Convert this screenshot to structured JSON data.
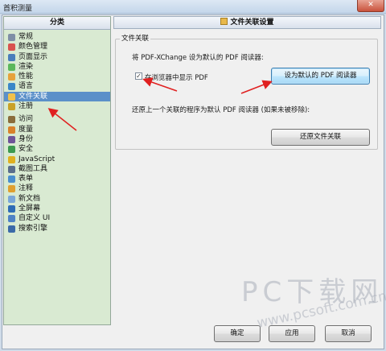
{
  "window": {
    "title": "首积测量",
    "close_label": "✕"
  },
  "sidebar": {
    "header": "分类",
    "items": [
      {
        "label": "常规",
        "icon": "gear-icon",
        "color": "#7f8fa6"
      },
      {
        "label": "颜色管理",
        "icon": "palette-icon",
        "color": "#d9534f"
      },
      {
        "label": "页面显示",
        "icon": "page-icon",
        "color": "#4a7ebb"
      },
      {
        "label": "渲染",
        "icon": "render-icon",
        "color": "#5cb85c"
      },
      {
        "label": "性能",
        "icon": "performance-icon",
        "color": "#e6a23c"
      },
      {
        "label": "语言",
        "icon": "language-icon",
        "color": "#3a87c8"
      },
      {
        "label": "文件关联",
        "icon": "file-association-icon",
        "color": "#f0c14b",
        "selected": true
      },
      {
        "label": "注册",
        "icon": "key-icon",
        "color": "#c9a227"
      },
      {
        "label": "访问",
        "icon": "access-icon",
        "color": "#8a6d3b",
        "sep": true
      },
      {
        "label": "度量",
        "icon": "ruler-icon",
        "color": "#d9822b"
      },
      {
        "label": "身份",
        "icon": "identity-icon",
        "color": "#6f5499"
      },
      {
        "label": "安全",
        "icon": "shield-icon",
        "color": "#3c9a4f"
      },
      {
        "label": "JavaScript",
        "icon": "javascript-icon",
        "color": "#e0b020"
      },
      {
        "label": "截图工具",
        "icon": "snapshot-icon",
        "color": "#5a6e8c"
      },
      {
        "label": "表单",
        "icon": "form-icon",
        "color": "#4a8fcf"
      },
      {
        "label": "注释",
        "icon": "comment-icon",
        "color": "#e0a030"
      },
      {
        "label": "新文档",
        "icon": "new-document-icon",
        "color": "#7aa7d9"
      },
      {
        "label": "全屏幕",
        "icon": "fullscreen-icon",
        "color": "#2f6db5"
      },
      {
        "label": "自定义 UI",
        "icon": "customize-icon",
        "color": "#4f83c5"
      },
      {
        "label": "搜索引擎",
        "icon": "search-engine-icon",
        "color": "#3b6aa8"
      }
    ]
  },
  "content": {
    "header": "文件关联设置",
    "group_title": "文件关联",
    "default_text": "将 PDF-XChange 设为默认的 PDF 阅读器:",
    "browser_checkbox_label": "在浏览器中显示 PDF",
    "browser_checkbox_checked": true,
    "set_default_button": "设为默认的 PDF 阅读器",
    "restore_text": "还原上一个关联的程序为默认 PDF 阅读器 (如果未被移除):",
    "restore_button": "还原文件关联"
  },
  "footer": {
    "ok_button": "确定",
    "apply_button": "应用",
    "cancel_button": "取消"
  },
  "watermark": {
    "title": "PC下载网",
    "url": "www.pcsoft.com.cn"
  },
  "colors": {
    "sidebar_bg": "#d9ead2",
    "selected_bg": "#5b90c9",
    "annotation_arrow": "#e02020"
  }
}
